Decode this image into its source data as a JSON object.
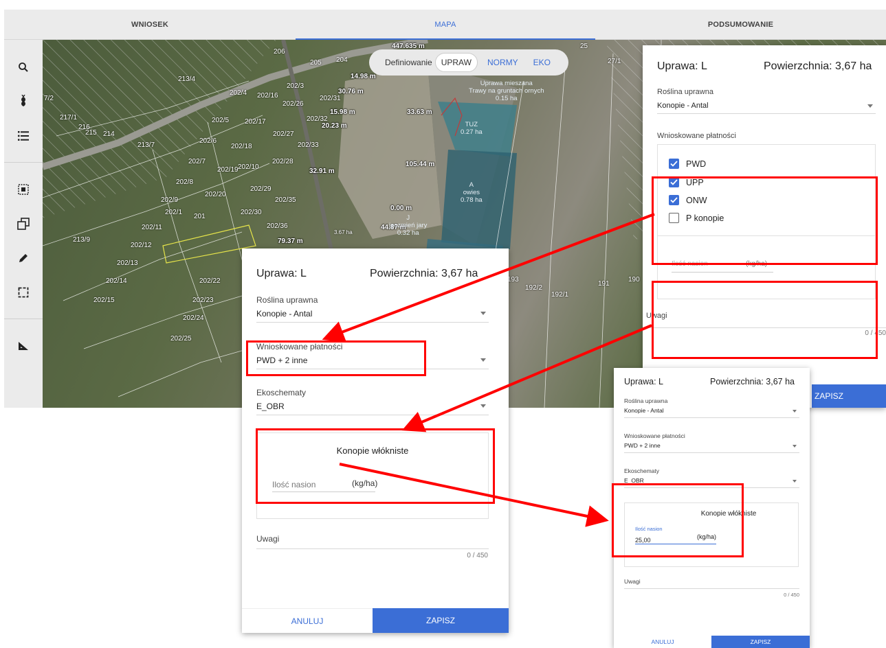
{
  "tabs": [
    {
      "label": "WNIOSEK"
    },
    {
      "label": "MAPA"
    },
    {
      "label": "PODSUMOWANIE"
    }
  ],
  "sidebar": {
    "tools": [
      "search-icon",
      "crop-icon",
      "list-icon",
      "select-icon",
      "copy-icon",
      "edit-icon",
      "frame-select-icon",
      "measure-icon"
    ]
  },
  "map": {
    "mode": {
      "prefix": "Definiowanie",
      "options": [
        "UPRAW",
        "NORMY",
        "EKO"
      ],
      "selected": "UPRAW"
    },
    "parcels": [
      "206",
      "205",
      "204",
      "25",
      "27/1",
      "213/4",
      "202/4",
      "202/16",
      "202/3",
      "202/26",
      "202/31",
      "7/2",
      "217/1",
      "216",
      "215",
      "214",
      "213/7",
      "202/5",
      "202/17",
      "202/27",
      "202/32",
      "202/6",
      "202/18",
      "202/33",
      "202/7",
      "202/19",
      "202/10",
      "202/28",
      "202/8",
      "202/20",
      "202/29",
      "202/9",
      "202/1",
      "201",
      "202/30",
      "202/35",
      "202/11",
      "202/36",
      "213/9",
      "202/12",
      "202/13",
      "202/14",
      "202/22",
      "202/15",
      "202/23",
      "202/24",
      "202/25",
      "193",
      "192/2",
      "192/1",
      "191",
      "190"
    ],
    "measurements": [
      "447.635 m",
      "14.98 m",
      "30.76 m",
      "15.98 m",
      "20.23 m",
      "33.63 m",
      "105.44 m",
      "32.91 m",
      "0.00 m",
      "44.87 m",
      "79.37 m",
      "3.67 ha"
    ],
    "crops": [
      {
        "line1": "Uprawa mieszana",
        "line2": "Trawy na gruntach ornych",
        "line3": "0.15 ha"
      },
      {
        "line1": "TUZ",
        "line2": "0.27 ha"
      },
      {
        "line1": "A",
        "line2": "owies",
        "line3": "0.78 ha"
      },
      {
        "line1": "J",
        "line2": "jęczmień jary",
        "line3": "0.32 ha"
      }
    ]
  },
  "panel_top_right": {
    "crop": "Uprawa: L",
    "area": "Powierzchnia: 3,67 ha",
    "plant_label": "Roślina uprawna",
    "plant_value": "Konopie - Antal",
    "payments_label": "Wnioskowane płatności",
    "payments": [
      {
        "label": "PWD",
        "checked": true
      },
      {
        "label": "UPP",
        "checked": true
      },
      {
        "label": "ONW",
        "checked": true
      },
      {
        "label": "P konopie",
        "checked": false
      }
    ],
    "seeds_label": "Ilość nasion",
    "seeds_unit": "(kg/ha)",
    "notes_label": "Uwagi",
    "notes_counter": "0 / 450",
    "save": "ZAPISZ"
  },
  "panel_center": {
    "crop": "Uprawa: L",
    "area": "Powierzchnia: 3,67 ha",
    "plant_label": "Roślina uprawna",
    "plant_value": "Konopie - Antal",
    "payments_label": "Wnioskowane płatności",
    "payments_value": "PWD + 2 inne",
    "eco_label": "Ekoschematy",
    "eco_value": "E_OBR",
    "section_title": "Konopie włókniste",
    "seeds_label": "Ilość nasion",
    "seeds_unit": "(kg/ha)",
    "notes_label": "Uwagi",
    "notes_counter": "0 / 450",
    "cancel": "ANULUJ",
    "save": "ZAPISZ"
  },
  "panel_bottom_right": {
    "crop": "Uprawa: L",
    "area": "Powierzchnia: 3,67 ha",
    "plant_label": "Roślina uprawna",
    "plant_value": "Konopie - Antal",
    "payments_label": "Wnioskowane płatności",
    "payments_value": "PWD + 2 inne",
    "eco_label": "Ekoschematy",
    "eco_value": "E_OBR",
    "section_title": "Konopie włókniste",
    "seeds_label": "Ilość nasion",
    "seeds_value": "25,00",
    "seeds_unit": "(kg/ha)",
    "notes_label": "Uwagi",
    "notes_counter": "0 / 450",
    "cancel": "ANULUJ",
    "save": "ZAPISZ"
  },
  "colors": {
    "accent": "#3b6ed6",
    "highlight": "#ff0000",
    "toolbar_bg": "#ebebeb"
  }
}
